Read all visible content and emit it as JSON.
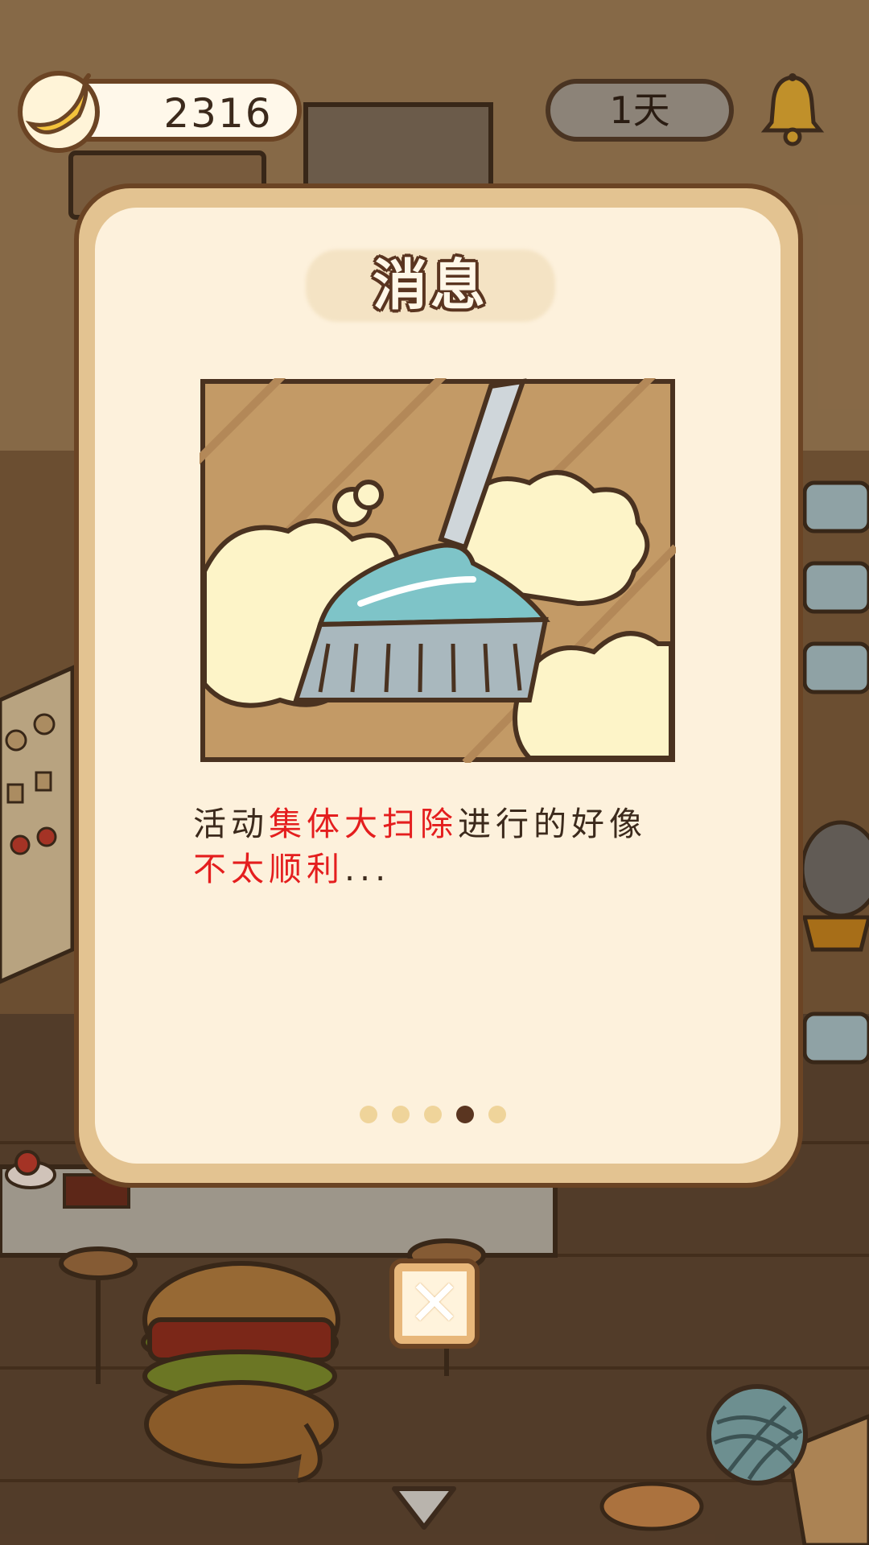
{
  "hud": {
    "banana_count": "2316",
    "day_label": "1天"
  },
  "modal": {
    "title": "消息",
    "message": {
      "part1": "活动",
      "highlight1": "集体大扫除",
      "part2": "进行的好像",
      "highlight2": "不太顺利",
      "part3": "..."
    },
    "pager": {
      "total": 5,
      "active_index": 3
    },
    "illustration": "broom-sweeping-dust"
  },
  "controls": {
    "close_icon": "close-icon",
    "yarn_icon": "yarn-ball-icon",
    "collapse_icon": "chevron-down-icon"
  },
  "colors": {
    "highlight": "#e41e1e",
    "frame": "#6b4424",
    "panel": "#fdf1dc",
    "panel_border": "#e3c391"
  }
}
